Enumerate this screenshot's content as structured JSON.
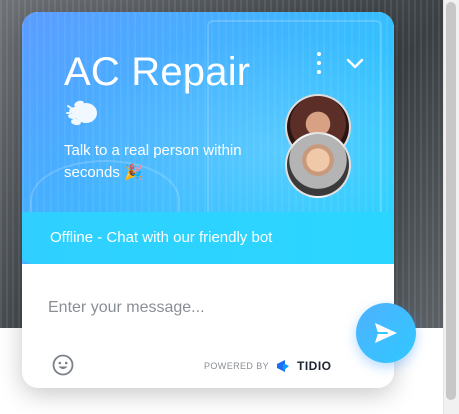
{
  "widget": {
    "title": "AC Repair",
    "subtitle": "Talk to a real person within seconds 🎉",
    "status": "Offline - Chat with our friendly bot"
  },
  "composer": {
    "placeholder": "Enter your message...",
    "powered_by": "POWERED BY",
    "brand": "TIDIO"
  },
  "colors": {
    "header_gradient_start": "#5b9cff",
    "header_gradient_end": "#1fd3ff",
    "send_button": "#2fc8ff"
  },
  "icons": {
    "hand": "waving-hand-icon",
    "menu": "kebab-menu-icon",
    "collapse": "chevron-down-icon",
    "emoji": "smiley-icon",
    "send": "paper-plane-icon",
    "brand": "tidio-logo-icon"
  }
}
